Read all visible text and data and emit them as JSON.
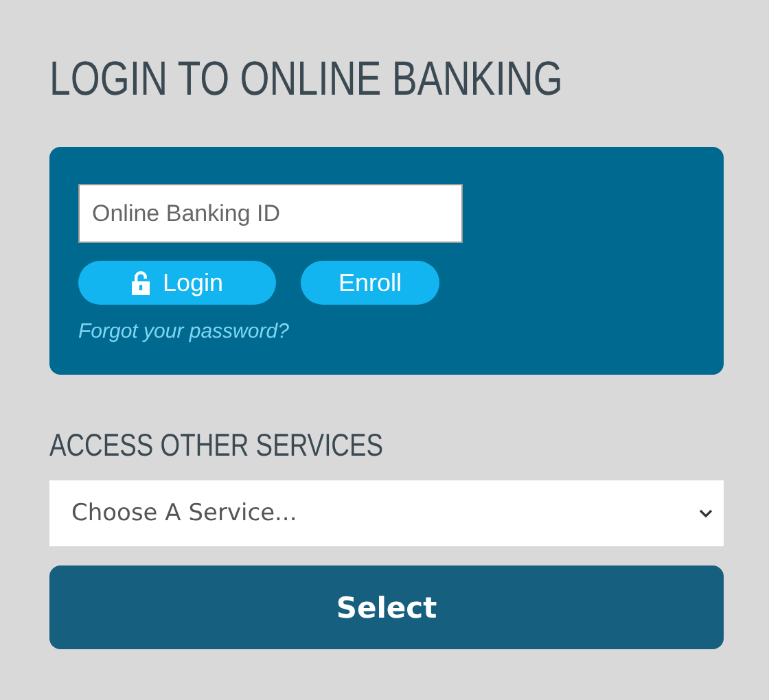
{
  "login": {
    "title": "LOGIN TO ONLINE BANKING",
    "id_field": {
      "placeholder": "Online Banking ID"
    },
    "buttons": [
      {
        "label": "Login",
        "kind": "lock"
      },
      {
        "label": "Enroll",
        "kind": "plain"
      }
    ],
    "forgot_link": "Forgot your password?"
  },
  "services": {
    "title": "ACCESS OTHER SERVICES",
    "dropdown": {
      "value": "Choose A Service..."
    },
    "button": "Select"
  }
}
